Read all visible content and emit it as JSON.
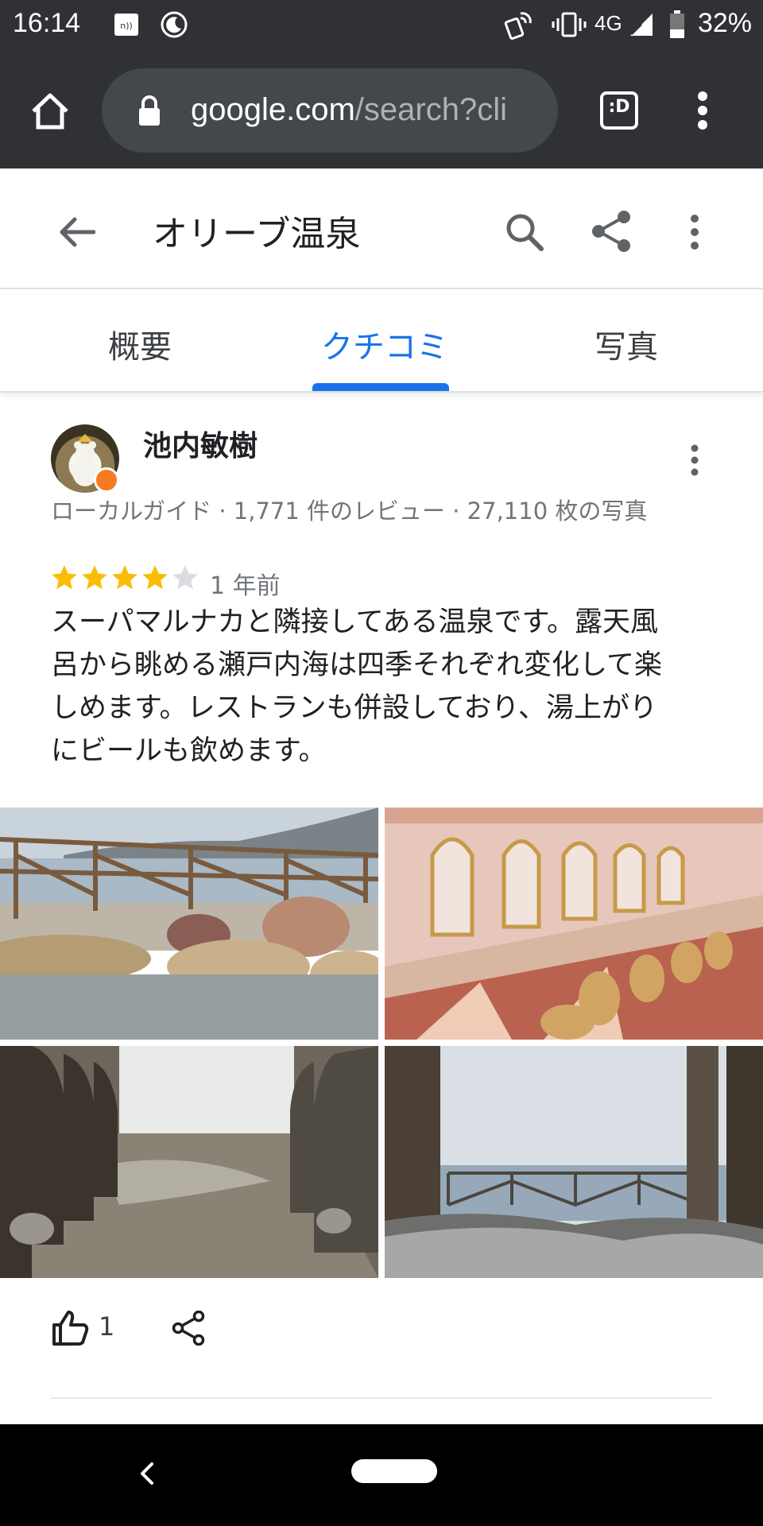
{
  "status_bar": {
    "time": "16:14",
    "network": "4G",
    "battery": "32%",
    "icons": [
      "nfc-icon",
      "do-not-disturb-moon-icon",
      "hotspot-icon",
      "vibrate-icon",
      "signal-icon",
      "battery-icon"
    ]
  },
  "browser": {
    "url_host": "google.com",
    "url_path": "/search?cli",
    "icons": [
      "home-icon",
      "lock-icon",
      "tab-switcher-icon",
      "overflow-menu-icon"
    ],
    "tab_switcher_label": ":D"
  },
  "place": {
    "title": "オリーブ温泉",
    "icons": [
      "back-arrow-icon",
      "search-icon",
      "share-icon",
      "more-vert-icon"
    ]
  },
  "tabs": [
    {
      "label": "概要",
      "active": false
    },
    {
      "label": "クチコミ",
      "active": true
    },
    {
      "label": "写真",
      "active": false
    }
  ],
  "review": {
    "author": "池内敏樹",
    "meta": "ローカルガイド · 1,771 件のレビュー · 27,110 枚の写真",
    "rating": 4,
    "max_rating": 5,
    "date": "1 年前",
    "text": "スーパマルナカと隣接してある温泉です。露天風呂から眺める瀬戸内海は四季それぞれ変化して楽しめます。レストランも併設しており、湯上がりにビールも飲めます。",
    "likes": "1",
    "photos": [
      "outdoor-bath-rocks-sea-photo",
      "dressing-room-vanity-photo",
      "indoor-bath-photo",
      "bath-sea-view-photo"
    ]
  },
  "colors": {
    "accent": "#1a73e8",
    "star": "#fbbc04",
    "browser_bar": "#2f3135"
  }
}
